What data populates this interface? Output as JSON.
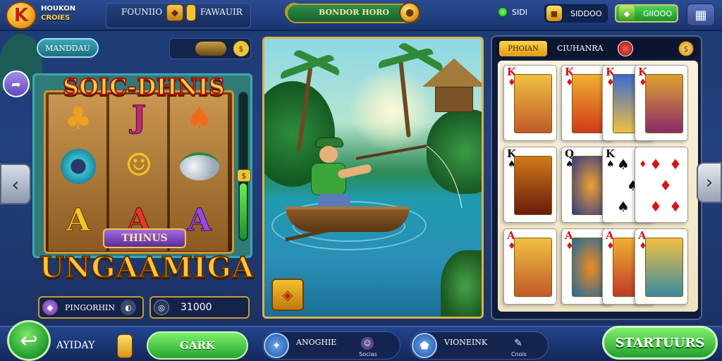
{
  "topbar": {
    "logo_letter": "K",
    "brand_line1": "HOUKON",
    "brand_line2": "CROIES",
    "tab1_label": "FOUNIIO",
    "tab2_label": "FAWAUIR",
    "banner_text": "BONDOR HORO",
    "coin_label": "SIDI",
    "pill1_value": "SIDDOO",
    "pill2_label": "GIIOOO",
    "menu_icon": "grid-icon"
  },
  "left_panel": {
    "mode_button": "MANDDAU",
    "slot_title": "SOIC-DHNIS",
    "ribbon": "THINUS",
    "big_title": "UNGAAMIGA",
    "symbol_1": "J",
    "symbol_2": "A",
    "symbol_3": "A",
    "symbol_4": "A",
    "foot1_label": "PINGORHIN",
    "foot2_value": "31000"
  },
  "right_panel": {
    "tab_label": "PHOIAN",
    "title": "CIUHANRA",
    "cards": [
      {
        "rank": "K",
        "suit": "♦",
        "color": "red"
      },
      {
        "rank": "K",
        "suit": "♦",
        "color": "red"
      },
      {
        "rank": "K",
        "suit": "♦",
        "color": "red"
      },
      {
        "rank": "K",
        "suit": "♦",
        "color": "red"
      },
      {
        "rank": "K",
        "suit": "♠",
        "color": "black"
      },
      {
        "rank": "Q",
        "suit": "♠",
        "color": "black"
      },
      {
        "rank": "K",
        "suit": "♠",
        "color": "black"
      },
      {
        "rank": "",
        "suit": "♦",
        "color": "red"
      },
      {
        "rank": "A",
        "suit": "♦",
        "color": "red"
      },
      {
        "rank": "A",
        "suit": "♦",
        "color": "red"
      },
      {
        "rank": "A",
        "suit": "♦",
        "color": "red"
      },
      {
        "rank": "A",
        "suit": "♦",
        "color": "red"
      }
    ]
  },
  "bottombar": {
    "day_label": "AYIDAY",
    "gark_button": "GARK",
    "item1_main": "ANOGHIE",
    "item1_small": "Socias",
    "item2_main": "VIONEINK",
    "item2_small": "Cnois",
    "start_button": "STARTUURS"
  },
  "colors": {
    "accent_gold": "#f0c43a",
    "green_button": "#25a52f",
    "panel_navy": "#14244e"
  }
}
